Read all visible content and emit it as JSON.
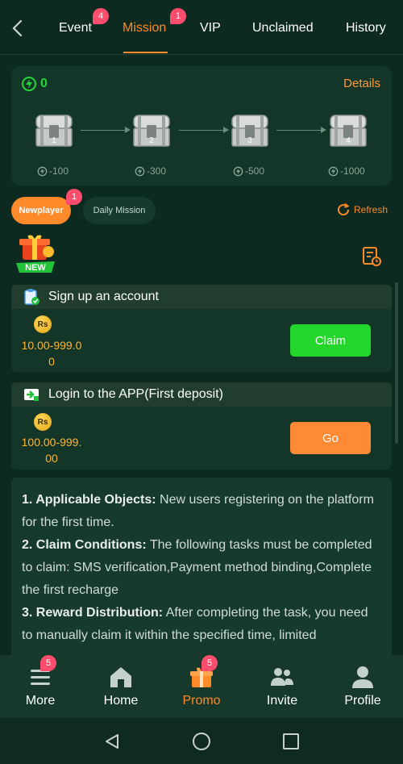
{
  "nav": {
    "tabs": [
      {
        "label": "Event",
        "badge": "4"
      },
      {
        "label": "Mission",
        "badge": "1"
      },
      {
        "label": "VIP"
      },
      {
        "label": "Unclaimed"
      },
      {
        "label": "History"
      }
    ]
  },
  "chests": {
    "energy": "0",
    "details_label": "Details",
    "items": [
      {
        "number": "1",
        "requirement": "-100"
      },
      {
        "number": "2",
        "requirement": "-300"
      },
      {
        "number": "3",
        "requirement": "-500"
      },
      {
        "number": "4",
        "requirement": "-1000"
      }
    ]
  },
  "subtabs": {
    "newplayer": "Newplayer",
    "newplayer_badge": "1",
    "daily": "Daily Mission",
    "refresh": "Refresh"
  },
  "gift_badge": "NEW",
  "tasks": [
    {
      "title": "Sign up an account",
      "currency": "Rs",
      "amount_line1": "10.00-999.0",
      "amount_line2": "0",
      "button": "Claim",
      "button_color": "#22d62b"
    },
    {
      "title": "Login to the APP(First deposit)",
      "currency": "Rs",
      "amount_line1": "100.00-999.",
      "amount_line2": "00",
      "button": "Go",
      "button_color": "#ff8a36"
    }
  ],
  "rules": [
    {
      "heading": "1. Applicable Objects:",
      "text": " New users registering on the platform for the first time."
    },
    {
      "heading": "2. Claim Conditions:",
      "text": " The following tasks must be completed to claim: SMS verification,Payment method binding,Complete the first recharge"
    },
    {
      "heading": "3. Reward Distribution:",
      "text": " After completing the task, you need to manually claim it within the specified time, limited"
    }
  ],
  "bottomnav": {
    "items": [
      {
        "label": "More",
        "badge": "5"
      },
      {
        "label": "Home"
      },
      {
        "label": "Promo",
        "badge": "5"
      },
      {
        "label": "Invite"
      },
      {
        "label": "Profile"
      }
    ]
  },
  "colors": {
    "accent": "#ff8a2a",
    "energy": "#22d63a",
    "background": "#0d2a20"
  }
}
